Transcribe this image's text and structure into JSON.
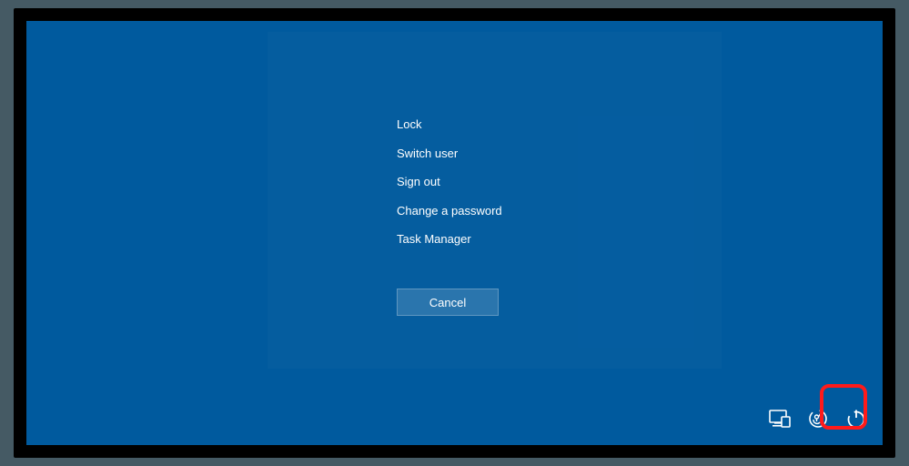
{
  "menu": {
    "items": [
      {
        "label": "Lock"
      },
      {
        "label": "Switch user"
      },
      {
        "label": "Sign out"
      },
      {
        "label": "Change a password"
      },
      {
        "label": "Task Manager"
      }
    ],
    "cancel_label": "Cancel"
  },
  "icons": {
    "network": "network-icon",
    "ease_of_access": "ease-of-access-icon",
    "power": "power-icon"
  },
  "colors": {
    "screen_bg": "#005a9e",
    "highlight": "#ff1a1a"
  }
}
